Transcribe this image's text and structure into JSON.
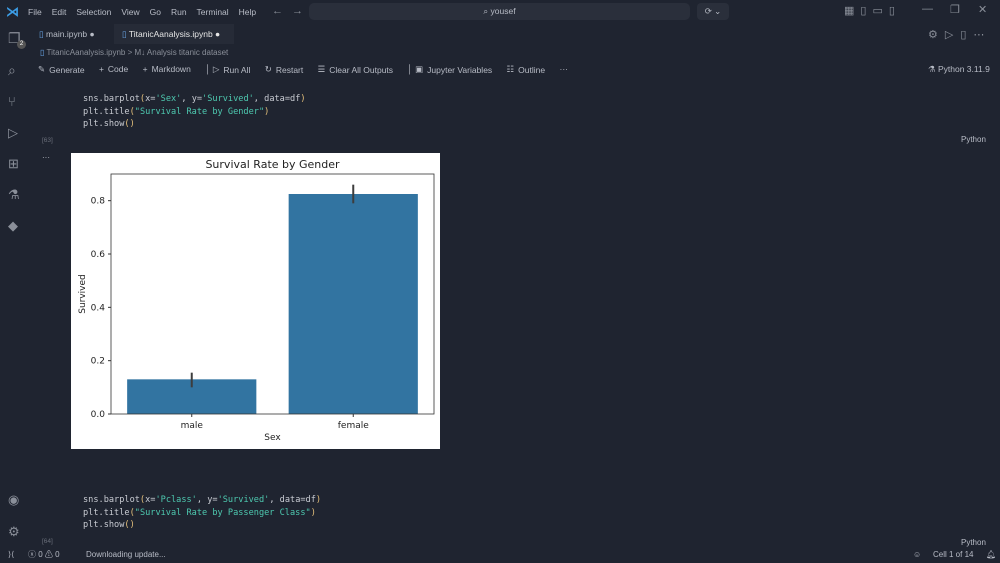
{
  "menu": [
    "File",
    "Edit",
    "Selection",
    "View",
    "Go",
    "Run",
    "Terminal",
    "Help"
  ],
  "search": "yousef",
  "tabs": [
    {
      "label": "main.ipynb"
    },
    {
      "label": "TitanicAanalysis.ipynb"
    }
  ],
  "breadcrumb": {
    "file": "TitanicAanalysis.ipynb",
    "section": "Analysis titanic dataset"
  },
  "toolbar": {
    "generate": "Generate",
    "code": "Code",
    "markdown": "Markdown",
    "run_all": "Run All",
    "restart": "Restart",
    "clear": "Clear All Outputs",
    "variables": "Jupyter Variables",
    "outline": "Outline",
    "more": "···",
    "kernel": "Python 3.11.9"
  },
  "activity_badge": "2",
  "cell1": {
    "lines": [
      "sns.barplot(x='Sex', y='Survived', data=df)",
      "plt.title(\"Survival Rate by Gender\")",
      "plt.show()"
    ],
    "count": "[63]",
    "lang": "Python",
    "more": "···"
  },
  "cell2": {
    "lines": [
      "sns.barplot(x='Pclass', y='Survived', data=df)",
      "plt.title(\"Survival Rate by Passenger Class\")",
      "plt.show()"
    ],
    "count": "[64]",
    "lang": "Python"
  },
  "status": {
    "errors": "0",
    "warnings": "0",
    "message": "Downloading update...",
    "cell": "Cell 1 of 14"
  },
  "chart_data": {
    "type": "bar",
    "title": "Survival Rate by Gender",
    "xlabel": "Sex",
    "ylabel": "Survived",
    "categories": [
      "male",
      "female"
    ],
    "values": [
      0.13,
      0.825
    ],
    "error_low": [
      0.1,
      0.79
    ],
    "error_high": [
      0.155,
      0.86
    ],
    "ylim": [
      0,
      0.9
    ],
    "yticks": [
      "0.0",
      "0.2",
      "0.4",
      "0.6",
      "0.8"
    ],
    "color": "#3274a1"
  }
}
